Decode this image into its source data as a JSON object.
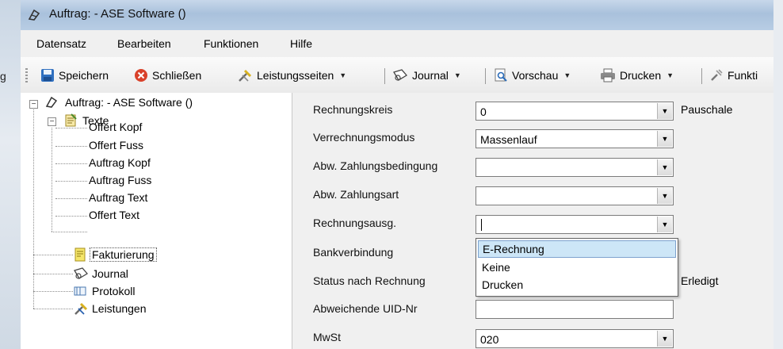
{
  "background": {
    "left_fragment": "g"
  },
  "window": {
    "title": "Auftrag:  - ASE Software ()"
  },
  "menu": [
    "Datensatz",
    "Bearbeiten",
    "Funktionen",
    "Hilfe"
  ],
  "toolbar": {
    "save": "Speichern",
    "close": "Schließen",
    "services": "Leistungsseiten",
    "journal": "Journal",
    "preview": "Vorschau",
    "print": "Drucken",
    "functions": "Funkti",
    "dropdown_arrow": "▼"
  },
  "tree": {
    "root": "Auftrag:  - ASE Software ()",
    "texte": "Texte",
    "children": [
      "Offert Kopf",
      "Offert Fuss",
      "Auftrag Kopf",
      "Auftrag Fuss",
      "Auftrag Text",
      "Offert Text"
    ],
    "billing": "Fakturierung",
    "journal": "Journal",
    "protocol": "Protokoll",
    "services": "Leistungen"
  },
  "form": {
    "rows": [
      {
        "label": "Rechnungskreis",
        "value": "0",
        "side": "Pauschale"
      },
      {
        "label": "Verrechnungsmodus",
        "value": "Massenlauf"
      },
      {
        "label": "Abw. Zahlungsbedingung",
        "value": ""
      },
      {
        "label": "Abw. Zahlungsart",
        "value": ""
      },
      {
        "label": "Rechnungsausg.",
        "value": ""
      },
      {
        "label": "Bankverbindung"
      },
      {
        "label": "Status nach Rechnung",
        "side": "Erledigt"
      },
      {
        "label": "Abweichende UID-Nr",
        "value": ""
      },
      {
        "label": "MwSt",
        "value": "020"
      }
    ],
    "dropdown_options": [
      "E-Rechnung",
      "Keine",
      "Drucken"
    ],
    "combo_arrow": "▼"
  },
  "colors": {
    "titlebar": "#b3c9e2",
    "selection": "#cde6f7",
    "window_bg": "#f0f0f0"
  }
}
